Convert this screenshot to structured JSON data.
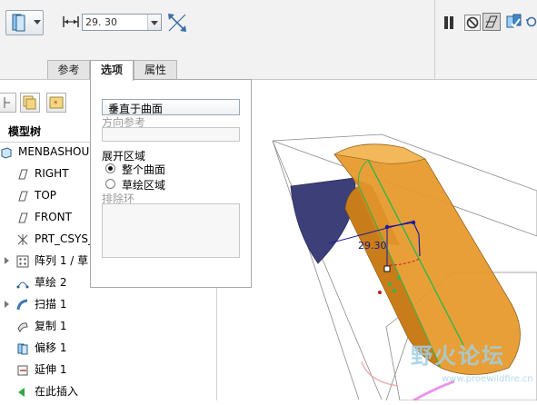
{
  "dashboard": {
    "length_value": "29. 30",
    "tabs": [
      {
        "label": "参考"
      },
      {
        "label": "选项"
      },
      {
        "label": "属性"
      }
    ]
  },
  "options_panel": {
    "type_select": "垂直于曲面",
    "direction_ref_label": "方向参考",
    "unfold_region_label": "展开区域",
    "radio_whole": "整个曲面",
    "radio_sketch": "草绘区域",
    "exclude_label": "排除环",
    "selected_radio": "整个曲面"
  },
  "model_tree": {
    "title": "模型树",
    "items": [
      {
        "label": "MENBASHOU",
        "icon": "part-icon"
      },
      {
        "label": "RIGHT",
        "icon": "datum-plane-icon"
      },
      {
        "label": "TOP",
        "icon": "datum-plane-icon"
      },
      {
        "label": "FRONT",
        "icon": "datum-plane-icon"
      },
      {
        "label": "PRT_CSYS_",
        "icon": "csys-icon"
      },
      {
        "label": "阵列 1 / 草",
        "icon": "pattern-icon"
      },
      {
        "label": "草绘 2",
        "icon": "sketch-icon"
      },
      {
        "label": "扫描 1",
        "icon": "sweep-icon"
      },
      {
        "label": "复制 1",
        "icon": "copy-icon"
      },
      {
        "label": "偏移 1",
        "icon": "offset-icon"
      },
      {
        "label": "延伸 1",
        "icon": "extend-icon"
      },
      {
        "label": "在此插入",
        "icon": "insert-here-icon"
      }
    ]
  },
  "viewport": {
    "dimension_label": "29.30",
    "watermark_cn": "野火论坛",
    "watermark_url": "www.proewildfire.cn"
  },
  "colors": {
    "model_orange": "#e89a2e",
    "surface_blue": "#3d3f78",
    "edge_green": "#2fb84a",
    "dimension_blue": "#1a1aa0"
  }
}
